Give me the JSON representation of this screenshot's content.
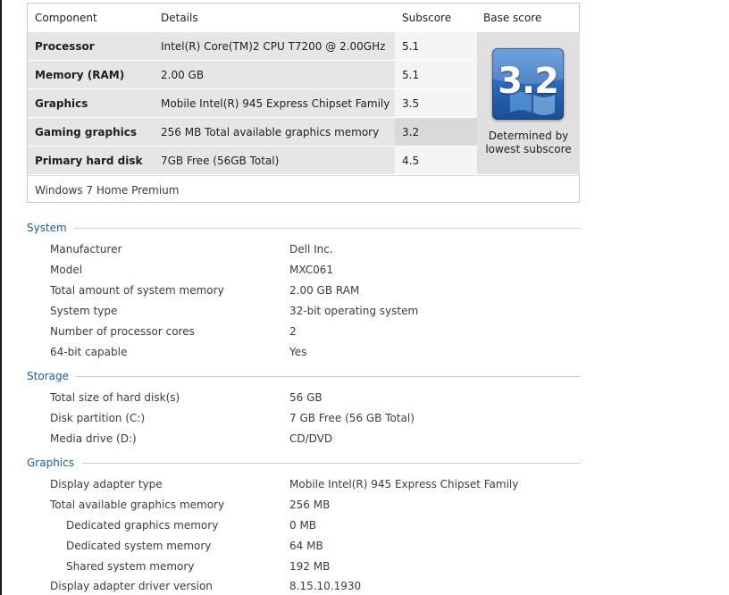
{
  "score_table": {
    "headers": {
      "component": "Component",
      "details": "Details",
      "subscore": "Subscore",
      "base_score": "Base score"
    },
    "rows": [
      {
        "component": "Processor",
        "details": "Intel(R) Core(TM)2 CPU T7200 @ 2.00GHz",
        "subscore": "5.1"
      },
      {
        "component": "Memory (RAM)",
        "details": "2.00 GB",
        "subscore": "5.1"
      },
      {
        "component": "Graphics",
        "details": "Mobile Intel(R) 945 Express Chipset Family",
        "subscore": "3.5"
      },
      {
        "component": "Gaming graphics",
        "details": "256 MB Total available graphics memory",
        "subscore": "3.2"
      },
      {
        "component": "Primary hard disk",
        "details": "7GB Free (56GB Total)",
        "subscore": "4.5"
      }
    ],
    "base_score": "3.2",
    "base_note_line1": "Determined by",
    "base_note_line2": "lowest subscore",
    "edition": "Windows 7 Home Premium"
  },
  "system": {
    "title": "System",
    "rows": [
      {
        "label": "Manufacturer",
        "value": "Dell Inc."
      },
      {
        "label": "Model",
        "value": "MXC061"
      },
      {
        "label": "Total amount of system memory",
        "value": "2.00 GB RAM"
      },
      {
        "label": "System type",
        "value": "32-bit operating system"
      },
      {
        "label": "Number of processor cores",
        "value": "2"
      },
      {
        "label": "64-bit capable",
        "value": "Yes"
      }
    ]
  },
  "storage": {
    "title": "Storage",
    "rows": [
      {
        "label": "Total size of hard disk(s)",
        "value": "56 GB"
      },
      {
        "label": "Disk partition (C:)",
        "value": "7 GB Free (56 GB Total)"
      },
      {
        "label": "Media drive (D:)",
        "value": "CD/DVD"
      }
    ]
  },
  "graphics": {
    "title": "Graphics",
    "rows": [
      {
        "label": "Display adapter type",
        "value": "Mobile Intel(R) 945 Express Chipset Family"
      },
      {
        "label": "Total available graphics memory",
        "value": "256 MB"
      },
      {
        "label": "Dedicated graphics memory",
        "value": "0 MB"
      },
      {
        "label": "Dedicated system memory",
        "value": "64 MB"
      },
      {
        "label": "Shared system memory",
        "value": "192 MB"
      },
      {
        "label": "Display adapter driver version",
        "value": "8.15.10.1930"
      }
    ]
  },
  "colors": {
    "section_title": "#1e5aa3",
    "row_shade": "#e6e6e6",
    "lowest_subscore_shade": "#d9d9d9",
    "badge_blue": "#2a66b8"
  },
  "icons": {
    "score_badge": "windows-experience-index-badge"
  }
}
